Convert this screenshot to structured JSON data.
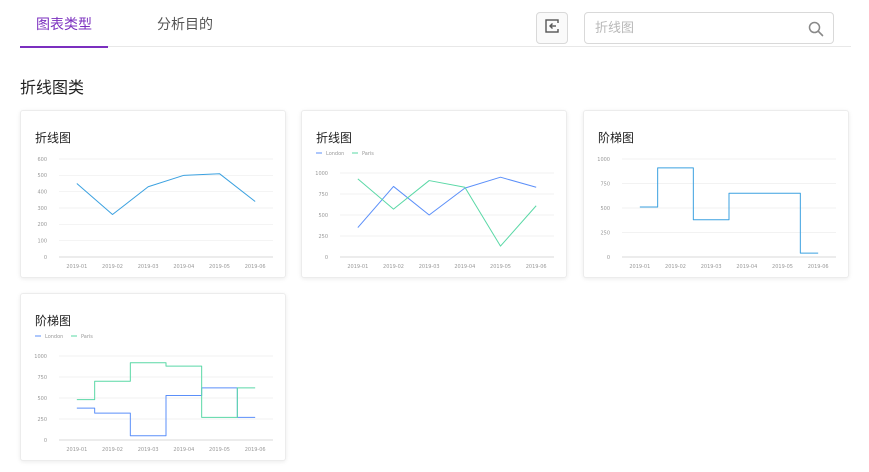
{
  "tabs": [
    {
      "label": "图表类型",
      "active": true
    },
    {
      "label": "分析目的",
      "active": false
    }
  ],
  "toolbar": {
    "exit_icon": "exit-icon"
  },
  "search": {
    "placeholder": "折线图",
    "value": "",
    "icon": "search-icon"
  },
  "section": {
    "title": "折线图类"
  },
  "colors": {
    "accent": "#7b2fbf",
    "london": "#5b8ff9",
    "paris": "#5ad8a6",
    "single": "#3ba1e0"
  },
  "cards": [
    {
      "title": "折线图",
      "chart_data": {
        "type": "line",
        "categories": [
          "2019-01",
          "2019-02",
          "2019-03",
          "2019-04",
          "2019-05",
          "2019-06"
        ],
        "series": [
          {
            "values": [
              450,
              260,
              430,
              500,
              510,
              340
            ]
          }
        ],
        "ylim": [
          0,
          600
        ],
        "yticks": [
          0,
          100,
          200,
          300,
          400,
          500,
          600
        ],
        "grid": true,
        "step": false
      }
    },
    {
      "title": "折线图",
      "chart_data": {
        "type": "line",
        "categories": [
          "2019-01",
          "2019-02",
          "2019-03",
          "2019-04",
          "2019-05",
          "2019-06"
        ],
        "series": [
          {
            "name": "London",
            "values": [
              350,
              840,
              500,
              820,
              950,
              830
            ]
          },
          {
            "name": "Paris",
            "values": [
              930,
              570,
              910,
              830,
              130,
              610
            ]
          }
        ],
        "ylim": [
          0,
          1000
        ],
        "yticks": [
          0,
          250,
          500,
          750,
          1000
        ],
        "grid": true,
        "legend": "top-left",
        "step": false
      }
    },
    {
      "title": "阶梯图",
      "chart_data": {
        "type": "line",
        "categories": [
          "2019-01",
          "2019-02",
          "2019-03",
          "2019-04",
          "2019-05",
          "2019-06"
        ],
        "series": [
          {
            "values": [
              510,
              910,
              380,
              650,
              650,
              40
            ]
          }
        ],
        "ylim": [
          0,
          1000
        ],
        "yticks": [
          0,
          250,
          500,
          750,
          1000
        ],
        "grid": true,
        "step": true
      }
    },
    {
      "title": "阶梯图",
      "chart_data": {
        "type": "line",
        "categories": [
          "2019-01",
          "2019-02",
          "2019-03",
          "2019-04",
          "2019-05",
          "2019-06"
        ],
        "series": [
          {
            "name": "London",
            "values": [
              380,
              320,
              50,
              530,
              620,
              270
            ]
          },
          {
            "name": "Paris",
            "values": [
              480,
              700,
              920,
              880,
              270,
              620
            ]
          }
        ],
        "ylim": [
          0,
          1000
        ],
        "yticks": [
          0,
          250,
          500,
          750,
          1000
        ],
        "grid": true,
        "legend": "top-left",
        "step": true
      }
    }
  ]
}
